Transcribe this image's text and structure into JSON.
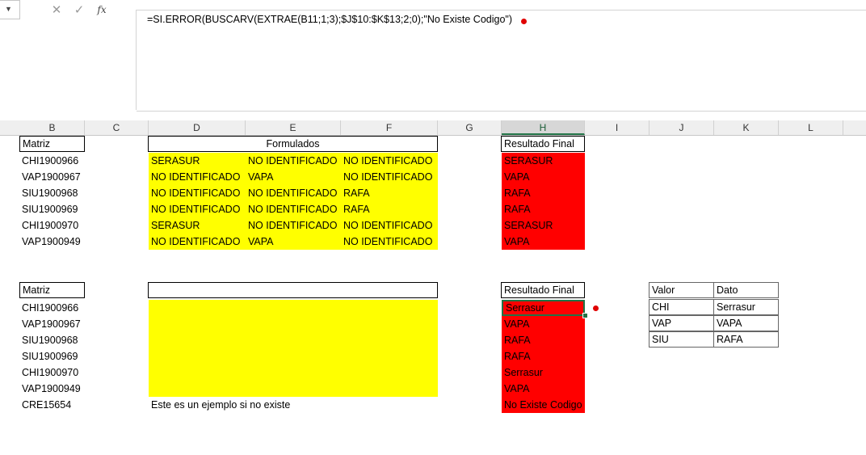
{
  "formula_bar": {
    "cancel_icon": "✕",
    "enter_icon": "✓",
    "fx_label": "fx",
    "formula": "=SI.ERROR(BUSCARV(EXTRAE(B11;1;3);$J$10:$K$13;2;0);\"No Existe Codigo\")"
  },
  "columns": [
    "B",
    "C",
    "D",
    "E",
    "F",
    "G",
    "H",
    "I",
    "J",
    "K",
    "L"
  ],
  "selected_column": "H",
  "colors": {
    "yellow": "#ffff00",
    "red": "#ff0000",
    "selection": "#217346"
  },
  "top_section": {
    "matriz_label": "Matriz",
    "formulados_label": "Formulados",
    "resultado_label": "Resultado Final",
    "rows": [
      {
        "code": "CHI1900966",
        "d": "SERASUR",
        "e": "NO IDENTIFICADO",
        "f": "NO IDENTIFICADO",
        "h": "SERASUR"
      },
      {
        "code": "VAP1900967",
        "d": "NO IDENTIFICADO",
        "e": "VAPA",
        "f": "NO IDENTIFICADO",
        "h": "VAPA"
      },
      {
        "code": "SIU1900968",
        "d": "NO IDENTIFICADO",
        "e": "NO IDENTIFICADO",
        "f": "RAFA",
        "h": "RAFA"
      },
      {
        "code": "SIU1900969",
        "d": "NO IDENTIFICADO",
        "e": "NO IDENTIFICADO",
        "f": "RAFA",
        "h": "RAFA"
      },
      {
        "code": "CHI1900970",
        "d": "SERASUR",
        "e": "NO IDENTIFICADO",
        "f": "NO IDENTIFICADO",
        "h": "SERASUR"
      },
      {
        "code": "VAP1900949",
        "d": "NO IDENTIFICADO",
        "e": "VAPA",
        "f": "NO IDENTIFICADO",
        "h": "VAPA"
      }
    ]
  },
  "bottom_section": {
    "matriz_label": "Matriz",
    "resultado_label": "Resultado Final",
    "rows": [
      {
        "code": "CHI1900966",
        "h": "Serrasur"
      },
      {
        "code": "VAP1900967",
        "h": "VAPA"
      },
      {
        "code": "SIU1900968",
        "h": "RAFA"
      },
      {
        "code": "SIU1900969",
        "h": "RAFA"
      },
      {
        "code": "CHI1900970",
        "h": "Serrasur"
      },
      {
        "code": "VAP1900949",
        "h": "VAPA"
      },
      {
        "code": "CRE15654",
        "h": "No Existe Codigo"
      }
    ],
    "note": "Este es un ejemplo si no existe"
  },
  "lookup_table": {
    "header_valor": "Valor",
    "header_dato": "Dato",
    "rows": [
      {
        "valor": "CHI",
        "dato": "Serrasur"
      },
      {
        "valor": "VAP",
        "dato": "VAPA"
      },
      {
        "valor": "SIU",
        "dato": "RAFA"
      }
    ]
  }
}
